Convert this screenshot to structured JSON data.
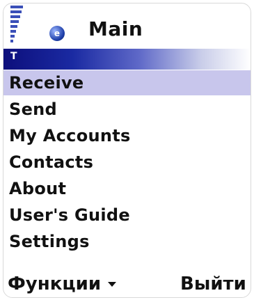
{
  "header": {
    "title": "Main",
    "app_icon_letter": "e",
    "signal_icon": "signal-strength-icon"
  },
  "band": {
    "glyph": "T"
  },
  "menu": {
    "items": [
      {
        "label": "Receive",
        "selected": true
      },
      {
        "label": "Send"
      },
      {
        "label": "My Accounts"
      },
      {
        "label": "Contacts"
      },
      {
        "label": "About"
      },
      {
        "label": "User's Guide"
      },
      {
        "label": "Settings"
      }
    ]
  },
  "softkeys": {
    "left": "Функции",
    "right": "Выйти",
    "left_icon": "chevron-down-icon"
  },
  "colors": {
    "selection": "#c8c6ec",
    "band_start": "#0d0f7c",
    "band_end": "#ffffff",
    "signal": "#3a4fb8"
  }
}
